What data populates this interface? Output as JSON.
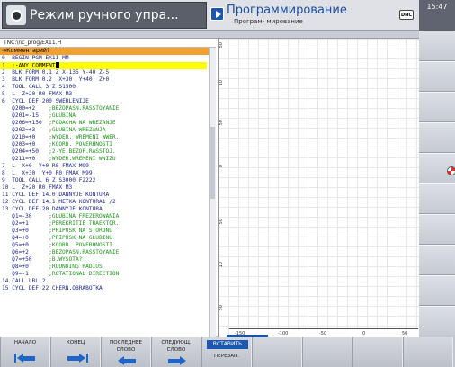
{
  "header": {
    "machine_mode": "Режим ручного упра...",
    "programming_mode": "Программирование",
    "programming_sub": "Програм- мирование",
    "dnc": "DNC",
    "clock": "15:47"
  },
  "program": {
    "path": "TNC:\\nc_prog\\EX11.H",
    "comment_header": "→Комментарий?",
    "lines": [
      {
        "n": "0",
        "code": "BEGIN PGM EX11 MM",
        "comment": ""
      },
      {
        "n": "1",
        "code": ";-ANY COMMENT",
        "comment": "",
        "selected": true
      },
      {
        "n": "2",
        "code": "BLK FORM 0.1 Z X-135 Y-40 Z-5",
        "comment": ""
      },
      {
        "n": "3",
        "code": "BLK FORM 0.2  X+30  Y+40  Z+0",
        "comment": ""
      },
      {
        "n": "4",
        "code": "TOOL CALL 3 Z S1500",
        "comment": ""
      },
      {
        "n": "5",
        "code": "L  Z+20 R0 FMAX M3",
        "comment": ""
      },
      {
        "n": "6",
        "code": "CYCL DEF 200 SWERLENIJE",
        "comment": ""
      },
      {
        "n": "",
        "code": "   Q200=+2    ",
        "comment": ";BEZOPASN.RASSTOYANIE"
      },
      {
        "n": "",
        "code": "   Q201=-15   ",
        "comment": ";GLUBINA"
      },
      {
        "n": "",
        "code": "   Q206=+150  ",
        "comment": ";PODACHA NA WREZANJE"
      },
      {
        "n": "",
        "code": "   Q202=+3    ",
        "comment": ";GLUBINA WREZANJA"
      },
      {
        "n": "",
        "code": "   Q210=+0    ",
        "comment": ";WYDER. WREMENI WWER."
      },
      {
        "n": "",
        "code": "   Q203=+0    ",
        "comment": ";KOORD. POVERHNOSTI"
      },
      {
        "n": "",
        "code": "   Q204=+50   ",
        "comment": ";2-YE BEZOP.RASSTOJ."
      },
      {
        "n": "",
        "code": "   Q211=+0    ",
        "comment": ";WYDER.WREMENI WNIZU"
      },
      {
        "n": "7",
        "code": "L  X+0  Y+0 R0 FMAX M99",
        "comment": ""
      },
      {
        "n": "8",
        "code": "L  X+30  Y+0 R0 FMAX M99",
        "comment": ""
      },
      {
        "n": "9",
        "code": "TOOL CALL 6 Z S3000 F2222",
        "comment": ""
      },
      {
        "n": "10",
        "code": "L  Z+20 R0 FMAX M3",
        "comment": ""
      },
      {
        "n": "11",
        "code": "CYCL DEF 14.0 DANNYJE KONTURA",
        "comment": ""
      },
      {
        "n": "12",
        "code": "CYCL DEF 14.1 METKA KONTURA1 /2",
        "comment": ""
      },
      {
        "n": "13",
        "code": "CYCL DEF 20 DANNYJE KONTURA",
        "comment": ""
      },
      {
        "n": "",
        "code": "   Q1=-30     ",
        "comment": ";GLUBINA FREZEROWANIA"
      },
      {
        "n": "",
        "code": "   Q2=+1      ",
        "comment": ";PEREKRITIE TRAEKTOR."
      },
      {
        "n": "",
        "code": "   Q3=+0      ",
        "comment": ";PRIPUSK NA STORONU"
      },
      {
        "n": "",
        "code": "   Q4=+0      ",
        "comment": ";PRIPUSK NA GLUBINU"
      },
      {
        "n": "",
        "code": "   Q5=+0      ",
        "comment": ";KOORD. POVERHNOSTI"
      },
      {
        "n": "",
        "code": "   Q6=+2      ",
        "comment": ";BEZOPASN.RASSTOYANIE"
      },
      {
        "n": "",
        "code": "   Q7=+50     ",
        "comment": ";B.WYSOTA?"
      },
      {
        "n": "",
        "code": "   Q8=+0      ",
        "comment": ";ROUNDING RADIUS"
      },
      {
        "n": "",
        "code": "   Q9=-1      ",
        "comment": ";ROTATIONAL DIRECTION"
      },
      {
        "n": "14",
        "code": "CALL LBL 2",
        "comment": ""
      },
      {
        "n": "15",
        "code": "CYCL DEF 22 CHERN.OBRABOTKA",
        "comment": ""
      }
    ]
  },
  "graphics": {
    "v_ticks": [
      "50",
      "10",
      "50",
      "0",
      "50",
      "10",
      "50"
    ],
    "h_ticks": [
      "-150",
      "-100",
      "-50",
      "0",
      "50"
    ]
  },
  "softkeys": [
    {
      "l1": "НАЧАЛО",
      "l2": "",
      "icon": "arrow-left-start"
    },
    {
      "l1": "КОНЕЦ",
      "l2": "",
      "icon": "arrow-right-end"
    },
    {
      "l1": "ПОСЛЕДНЕЕ",
      "l2": "СЛОВО",
      "icon": "arrow-left"
    },
    {
      "l1": "СЛЕДУЮЩ.",
      "l2": "СЛОВО",
      "icon": "arrow-right"
    },
    {
      "l1": "ВСТАВИТЬ",
      "l2": "ПЕРЕЗАП.",
      "icon": ""
    }
  ],
  "colors": {
    "accent": "#1d58b0",
    "selection": "#ffff00",
    "comment": "#20961c",
    "code": "#1c2a88",
    "comment_hdr": "#f0a030"
  }
}
